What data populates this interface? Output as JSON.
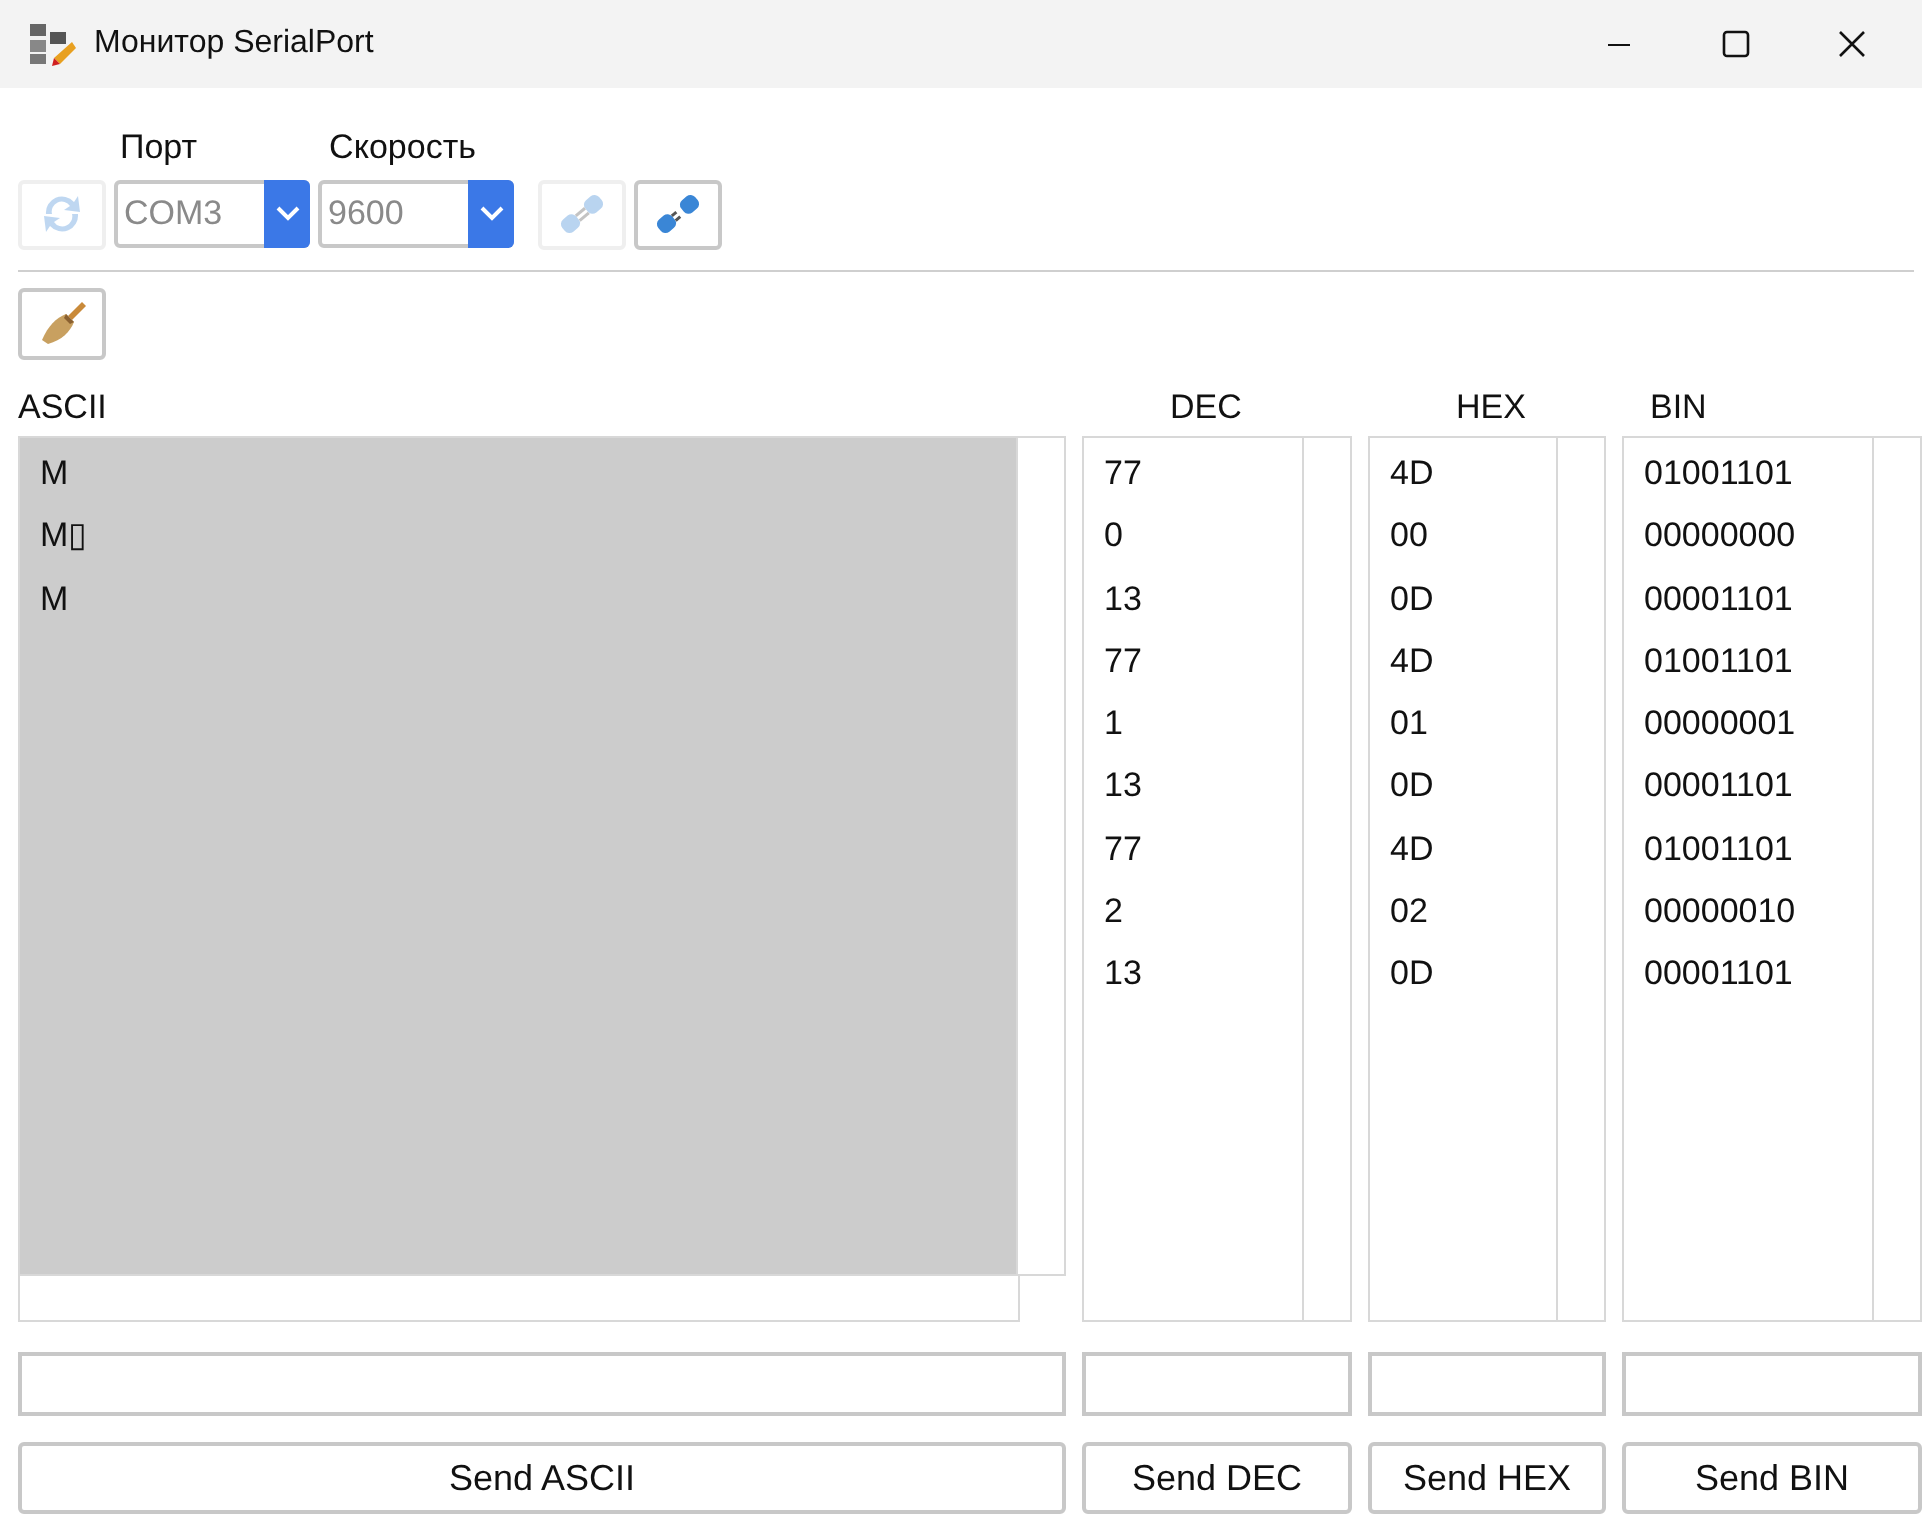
{
  "window": {
    "title": "Монитор SerialPort"
  },
  "toolbar": {
    "refresh_button": {
      "disabled": true
    },
    "port": {
      "label": "Порт",
      "value": "COM3",
      "disabled": true
    },
    "speed": {
      "label": "Скорость",
      "value": "9600",
      "disabled": true
    },
    "connect_button": {
      "disabled": true
    },
    "disconnect_button": {
      "disabled": false
    }
  },
  "panels": [
    {
      "kind": "ascii",
      "header": "ASCII",
      "lines": [
        "M",
        "M▯",
        "M"
      ],
      "send_label": "Send ASCII"
    },
    {
      "kind": "list",
      "header": "DEC",
      "lines": [
        "77",
        "0",
        "13",
        "77",
        "1",
        "13",
        "77",
        "2",
        "13"
      ],
      "send_label": "Send DEC"
    },
    {
      "kind": "list",
      "header": "HEX",
      "lines": [
        "4D",
        "00",
        "0D",
        "4D",
        "01",
        "0D",
        "4D",
        "02",
        "0D"
      ],
      "send_label": "Send HEX"
    },
    {
      "kind": "list",
      "header": "BIN",
      "lines": [
        "01001101",
        "00000000",
        "00001101",
        "01001101",
        "00000001",
        "00001101",
        "01001101",
        "00000010",
        "00001101"
      ],
      "send_label": "Send BIN"
    }
  ]
}
